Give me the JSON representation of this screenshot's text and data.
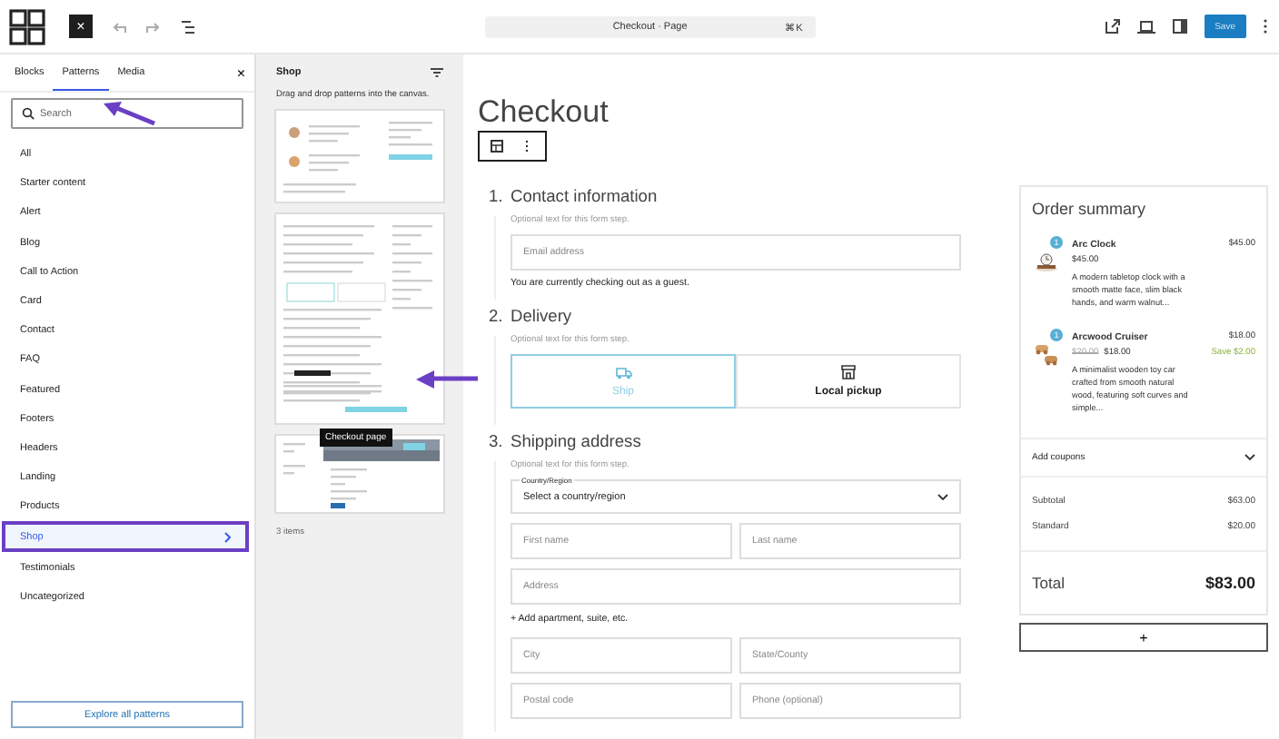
{
  "toolbar": {
    "close": "×",
    "command_title": "Checkout · Page",
    "shortcut": "⌘K",
    "save": "Save"
  },
  "inserter": {
    "tabs": [
      {
        "label": "Blocks",
        "selected": false
      },
      {
        "label": "Patterns",
        "selected": true
      },
      {
        "label": "Media",
        "selected": false
      }
    ],
    "close": "×",
    "search": {
      "placeholder": "Search"
    },
    "categories": [
      {
        "label": "All",
        "selected": false
      },
      {
        "label": "Starter content",
        "selected": false
      },
      {
        "label": "Alert",
        "selected": false
      },
      {
        "label": "Blog",
        "selected": false
      },
      {
        "label": "Call to Action",
        "selected": false
      },
      {
        "label": "Card",
        "selected": false
      },
      {
        "label": "Contact",
        "selected": false
      },
      {
        "label": "FAQ",
        "selected": false
      },
      {
        "label": "Featured",
        "selected": false
      },
      {
        "label": "Footers",
        "selected": false
      },
      {
        "label": "Headers",
        "selected": false
      },
      {
        "label": "Landing",
        "selected": false
      },
      {
        "label": "Products",
        "selected": false
      },
      {
        "label": "Shop",
        "selected": true
      },
      {
        "label": "Testimonials",
        "selected": false
      },
      {
        "label": "Uncategorized",
        "selected": false
      }
    ],
    "explore": "Explore all patterns"
  },
  "patterns_panel": {
    "title": "Shop",
    "hint": "Drag and drop patterns into the canvas.",
    "tooltip": "Checkout page",
    "count": "3 items"
  },
  "canvas": {
    "title": "Checkout",
    "steps": [
      {
        "number": "1.",
        "title": "Contact information",
        "hint": "Optional text for this form step.",
        "items": [
          {
            "kind": "field",
            "placeholder": "Email address"
          },
          {
            "kind": "note",
            "text": "You are currently checking out as a guest."
          }
        ]
      },
      {
        "number": "2.",
        "title": "Delivery",
        "hint": "Optional text for this form step.",
        "items": [
          {
            "kind": "options",
            "options": [
              {
                "kind": "ship",
                "label": "Ship",
                "selected": true
              },
              {
                "kind": "pickup",
                "label": "Local pickup",
                "selected": false
              }
            ]
          }
        ]
      },
      {
        "number": "3.",
        "title": "Shipping address",
        "hint": "Optional text for this form step.",
        "items": [
          {
            "kind": "select",
            "label": "Country/Region",
            "value": "Select a country/region"
          },
          {
            "kind": "pair",
            "fields": [
              {
                "placeholder": "First name"
              },
              {
                "placeholder": "Last name"
              }
            ]
          },
          {
            "kind": "field",
            "placeholder": "Address"
          },
          {
            "kind": "link",
            "text": "+ Add apartment, suite, etc."
          },
          {
            "kind": "pair",
            "fields": [
              {
                "placeholder": "City"
              },
              {
                "placeholder": "State/County"
              }
            ]
          },
          {
            "kind": "pair",
            "fields": [
              {
                "placeholder": "Postal code"
              },
              {
                "placeholder": "Phone (optional)"
              }
            ]
          }
        ]
      }
    ],
    "summary": {
      "title": "Order summary",
      "items": [
        {
          "quantity": "1",
          "name": "Arc Clock",
          "total": "$45.00",
          "price": "$45.00",
          "description": "A modern tabletop clock with a smooth matte face, slim black hands, and warm walnut..."
        },
        {
          "quantity": "1",
          "name": "Arcwood Cruiser",
          "total": "$18.00",
          "old_price": "$20.00",
          "price": "$18.00",
          "saving": "Save $2.00",
          "description": "A minimalist wooden toy car crafted from smooth natural wood, featuring soft curves and simple..."
        }
      ],
      "coupons": "Add coupons",
      "lines": [
        {
          "label": "Subtotal",
          "value": "$63.00"
        },
        {
          "label": "Standard",
          "value": "$20.00"
        }
      ],
      "total": {
        "label": "Total",
        "value": "$83.00"
      },
      "add": "+"
    }
  }
}
